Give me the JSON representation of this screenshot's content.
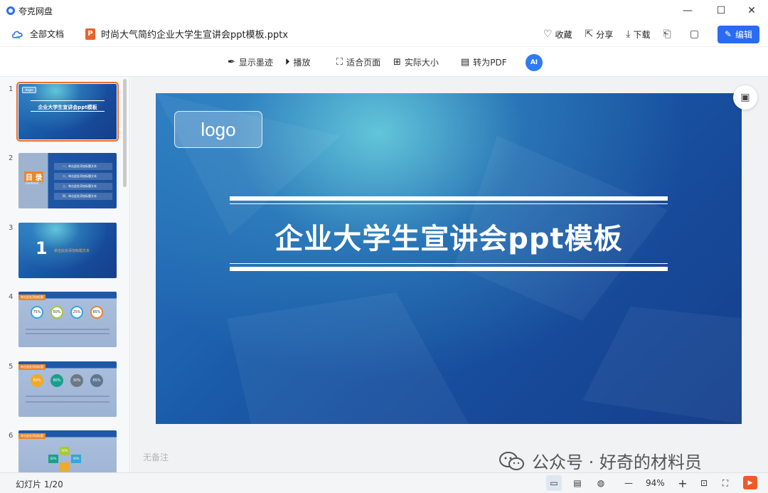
{
  "window": {
    "app_name": "夸克网盘",
    "controls": {
      "minimize": "—",
      "maximize": "☐",
      "close": "✕"
    }
  },
  "header": {
    "all_docs": "全部文档",
    "file_icon_letter": "P",
    "file_name": "时尚大气简约企业大学生宣讲会ppt模板.pptx",
    "actions": {
      "favorite": "收藏",
      "share": "分享",
      "download": "下载",
      "edit": "编辑"
    }
  },
  "toolbar": {
    "show_ink": "显示墨迹",
    "play": "播放",
    "fit_page": "适合页面",
    "actual_size": "实际大小",
    "to_pdf": "转为PDF",
    "ai_label": "AI"
  },
  "thumbnails": [
    {
      "number": "1",
      "logo": "logo",
      "title": "企业大学生宣讲会ppt模板",
      "selected": true
    },
    {
      "number": "2",
      "heading": "目 录",
      "sub": "Contents",
      "items": [
        "一、单击此处添加标题文本",
        "二、单击此处添加标题文本",
        "三、单击此处添加标题文本",
        "四、单击此处添加标题文本"
      ]
    },
    {
      "number": "3",
      "big": "1",
      "text": "单击此处添加标题文本"
    },
    {
      "number": "4",
      "tag": "单击此处添加标题",
      "circles": [
        "75%",
        "50%",
        "25%",
        "85%"
      ]
    },
    {
      "number": "5",
      "tag": "单击此处添加标题",
      "circles": [
        "50%",
        "80%",
        "30%",
        "65%"
      ]
    },
    {
      "number": "6",
      "tag": "单击此处添加标题",
      "hexes": [
        "90%",
        "60%",
        "40%"
      ]
    }
  ],
  "slide": {
    "logo": "logo",
    "title": "企业大学生宣讲会ppt模板"
  },
  "notes_placeholder": "无备注",
  "watermark": "公众号 · 好奇的材料员",
  "statusbar": {
    "slide_counter": "幻灯片 1/20",
    "zoom_out": "—",
    "zoom": "94%",
    "zoom_in": "+"
  },
  "colors": {
    "accent": "#2a6bf2",
    "ppt_orange": "#e9622c",
    "slide_blue": "#1a5aa8"
  }
}
